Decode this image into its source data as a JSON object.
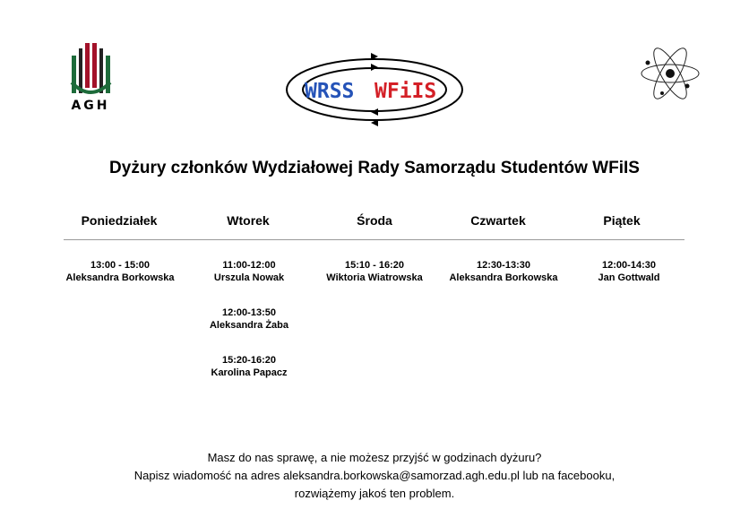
{
  "logos": {
    "agh_text": "AGH",
    "wrss_text": "WRSS WFiIS"
  },
  "title": "Dyżury członków Wydziałowej Rady Samorządu Studentów WFiIS",
  "days": [
    "Poniedziałek",
    "Wtorek",
    "Środa",
    "Czwartek",
    "Piątek"
  ],
  "schedule": {
    "monday": [
      {
        "time": "13:00 - 15:00",
        "person": "Aleksandra Borkowska"
      }
    ],
    "tuesday": [
      {
        "time": "11:00-12:00",
        "person": "Urszula Nowak"
      },
      {
        "time": "12:00-13:50",
        "person": "Aleksandra Żaba"
      },
      {
        "time": "15:20-16:20",
        "person": "Karolina Papacz"
      }
    ],
    "wednesday": [
      {
        "time": "15:10 - 16:20",
        "person": "Wiktoria Wiatrowska"
      }
    ],
    "thursday": [
      {
        "time": "12:30-13:30",
        "person": "Aleksandra Borkowska"
      }
    ],
    "friday": [
      {
        "time": "12:00-14:30",
        "person": "Jan Gottwald"
      }
    ]
  },
  "footer": {
    "line1": "Masz do nas sprawę, a nie możesz przyjść w godzinach dyżuru?",
    "line2": "Napisz wiadomość na adres aleksandra.borkowska@samorzad.agh.edu.pl lub na facebooku,",
    "line3": "rozwiążemy jakoś ten problem."
  },
  "colors": {
    "agh_green": "#1d6b3a",
    "agh_red": "#a3122a",
    "wrss_blue": "#2553b8",
    "wrss_red": "#d42027"
  }
}
